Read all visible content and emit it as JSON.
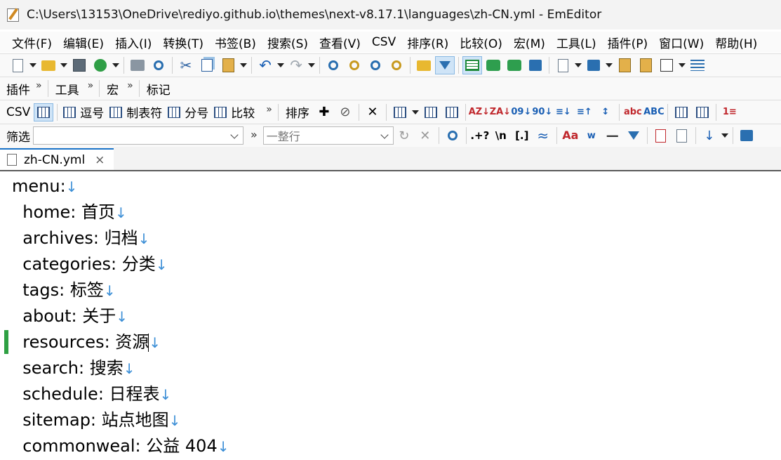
{
  "window": {
    "title": "C:\\Users\\13153\\OneDrive\\rediyo.github.io\\themes\\next-v8.17.1\\languages\\zh-CN.yml - EmEditor"
  },
  "menubar": [
    "文件(F)",
    "编辑(E)",
    "插入(I)",
    "转换(T)",
    "书签(B)",
    "搜索(S)",
    "查看(V)",
    "CSV",
    "排序(R)",
    "比较(O)",
    "宏(M)",
    "工具(L)",
    "插件(P)",
    "窗口(W)",
    "帮助(H)"
  ],
  "toolbar2": {
    "plugins": "插件",
    "tools": "工具",
    "macros": "宏",
    "markers": "标记"
  },
  "csvbar": {
    "csv": "CSV",
    "comma": "逗号",
    "tab": "制表符",
    "semicolon": "分号",
    "compare": "比较",
    "sort": "排序"
  },
  "filterbar": {
    "label": "筛选",
    "filter_value": "",
    "mode": "一整行",
    "chevrons": "»"
  },
  "tab": {
    "name": "zh-CN.yml",
    "close": "×"
  },
  "editor": {
    "newline_marker": "↓",
    "lines": [
      "menu:",
      "  home: 首页",
      "  archives: 归档",
      "  categories: 分类",
      "  tags: 标签",
      "  about: 关于",
      "  resources: 资源",
      "  search: 搜索",
      "  schedule: 日程表",
      "  sitemap: 站点地图",
      "  commonweal: 公益 404"
    ],
    "cursor_line": 7,
    "modified_line": 7
  },
  "colors": {
    "accent": "#1a73c8",
    "newline": "#3b8ed6",
    "modified": "#2ea043"
  }
}
